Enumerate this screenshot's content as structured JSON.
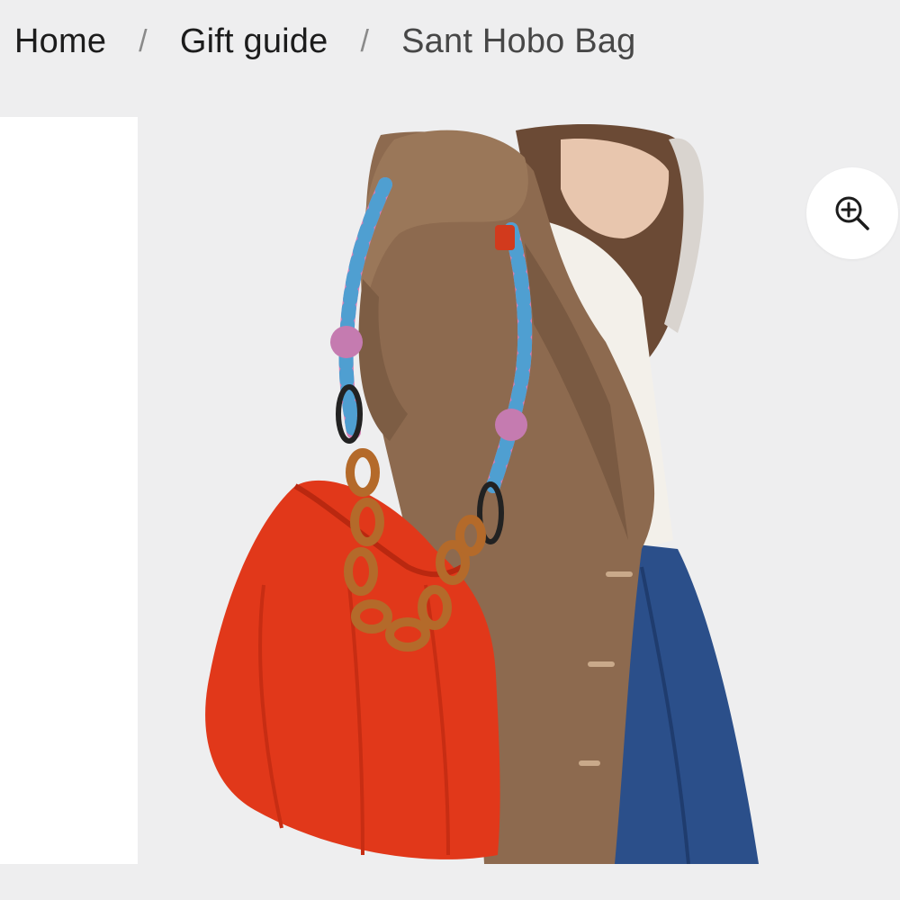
{
  "breadcrumb": {
    "items": [
      {
        "label": "Home"
      },
      {
        "label": "Gift guide"
      },
      {
        "label": "Sant Hobo Bag"
      }
    ],
    "separator": "/"
  },
  "gallery": {
    "image_alt": "",
    "zoom_icon": "zoom-in-icon"
  },
  "colors": {
    "page_background": "#eeeeef",
    "bag": "#e1381a",
    "coat": "#8d6a4f",
    "jeans": "#2b4f8a",
    "strap_pink": "#d57fb6",
    "strap_blue": "#4f9fd1"
  }
}
